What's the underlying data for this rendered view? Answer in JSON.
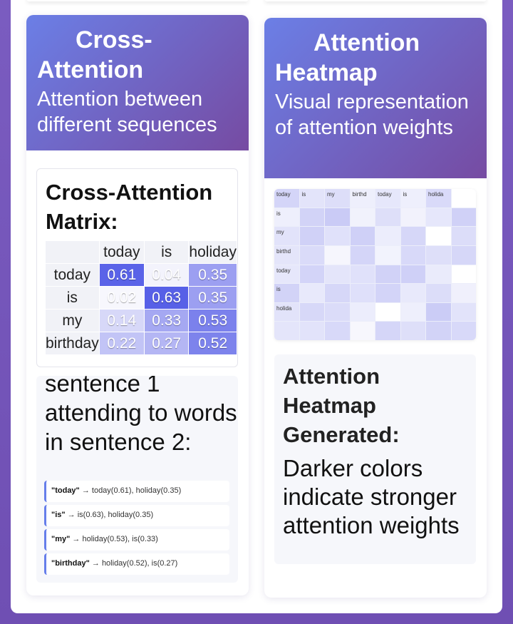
{
  "cross_attention": {
    "title": "Cross-Attention",
    "subtitle": "Attention between different sequences",
    "matrix_title": "Cross-Attention Matrix:",
    "columns": [
      "today",
      "is",
      "holiday"
    ],
    "rows": [
      {
        "label": "today",
        "values": [
          "0.61",
          "0.04",
          "0.35"
        ]
      },
      {
        "label": "is",
        "values": [
          "0.02",
          "0.63",
          "0.35"
        ]
      },
      {
        "label": "my",
        "values": [
          "0.14",
          "0.33",
          "0.53"
        ]
      },
      {
        "label": "birthday",
        "values": [
          "0.22",
          "0.27",
          "0.52"
        ]
      }
    ],
    "words_heading": "sentence 1 attending to words in sentence 2:",
    "word_items": [
      {
        "word": "\"today\"",
        "rest": " → today(0.61), holiday(0.35)"
      },
      {
        "word": "\"is\"",
        "rest": " → is(0.63), holiday(0.35)"
      },
      {
        "word": "\"my\"",
        "rest": " → holiday(0.53), is(0.33)"
      },
      {
        "word": "\"birthday\"",
        "rest": " → holiday(0.52), is(0.27)"
      }
    ]
  },
  "heatmap_card": {
    "title": "Attention Heatmap",
    "subtitle": "Visual representation of attention weights",
    "top_labels": [
      "today",
      "is",
      "my",
      "birthd",
      "today",
      "is",
      "holida",
      ""
    ],
    "left_labels": [
      "is",
      "my",
      "birthd",
      "today",
      "is",
      "holida",
      ""
    ],
    "result_title": "Attention Heatmap Generated:",
    "result_text": "Darker colors indicate stronger attention weights"
  }
}
